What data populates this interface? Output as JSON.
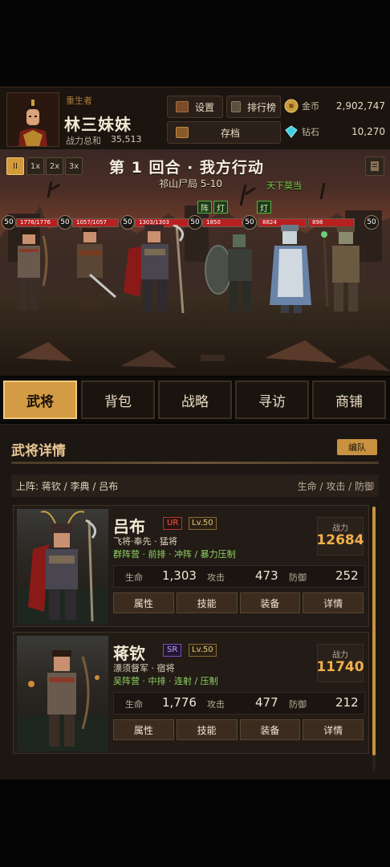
{
  "header": {
    "role_label": "重生者",
    "player_name": "林三妹妹",
    "power_label": "战力总和",
    "power_value": "35,513",
    "settings_label": "设置",
    "rank_label": "排行榜",
    "save_label": "存档",
    "gold_label": "金币",
    "gold_value": "2,902,747",
    "gem_label": "钻石",
    "gem_value": "10,270"
  },
  "battle": {
    "pause_label": "II",
    "speed_1x": "1x",
    "speed_2x": "2x",
    "speed_3x": "3x",
    "round_title": "第 1 回合 · 我方行动",
    "stage_name": "祁山尸局 5-10",
    "stage_tag": "天下莫当",
    "allies": [
      {
        "level": "50",
        "hp": "1776/1776",
        "hp_fraction": 1.0
      },
      {
        "level": "50",
        "hp": "1057/1057",
        "hp_fraction": 1.0
      },
      {
        "level": "50",
        "hp": "1303/1303",
        "hp_fraction": 1.0
      }
    ],
    "enemies": [
      {
        "level": "50",
        "hp": "1850",
        "hp_fraction": 1.0
      },
      {
        "level": "50",
        "hp": "8824",
        "hp_fraction": 1.0
      },
      {
        "level": "50",
        "hp": "898",
        "hp_fraction": 1.0
      }
    ],
    "buff_1a": "阵",
    "buff_1b": "灯",
    "buff_2": "灯"
  },
  "tabs": [
    "武将",
    "背包",
    "战略",
    "寻访",
    "商铺"
  ],
  "panel": {
    "title": "武将详情",
    "formation_label": "编队",
    "lineup_text": "上阵: 蒋钦 / 李典 / 吕布",
    "stat_labels": "生命 / 攻击 / 防御"
  },
  "heroes": [
    {
      "name": "吕布",
      "rarity": "UR",
      "level": "Lv.50",
      "title_line": "飞将·奉先 · 猛将",
      "tags_line": "群阵营 · 前排 · 冲阵 / 暴力压制",
      "power_label": "战力",
      "power": "12684",
      "hp_label": "生命",
      "hp": "1,303",
      "atk_label": "攻击",
      "atk": "473",
      "def_label": "防御",
      "def": "252",
      "actions": [
        "属性",
        "技能",
        "装备",
        "详情"
      ]
    },
    {
      "name": "蒋钦",
      "rarity": "SR",
      "level": "Lv.50",
      "title_line": "漂须督军 · 宿将",
      "tags_line": "吴阵营 · 中排 · 连射 / 压制",
      "power_label": "战力",
      "power": "11740",
      "hp_label": "生命",
      "hp": "1,776",
      "atk_label": "攻击",
      "atk": "477",
      "def_label": "防御",
      "def": "212",
      "actions": [
        "属性",
        "技能",
        "装备",
        "详情"
      ]
    }
  ],
  "colors": {
    "accent": "#d39b43",
    "hp_bar": "#b72020",
    "ur": "#ff5a4a",
    "sr": "#c9a0ff",
    "tag_green": "#8fd460",
    "power": "#f0b04a"
  }
}
